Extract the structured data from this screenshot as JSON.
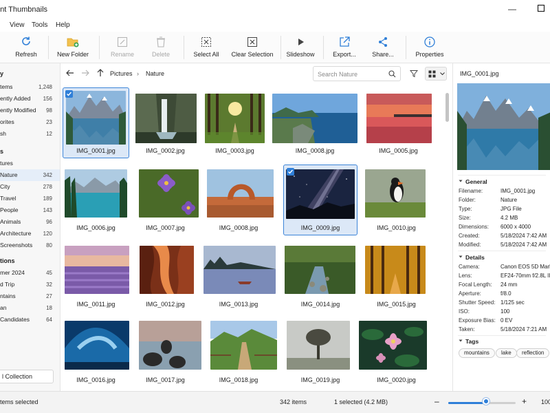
{
  "window": {
    "title": "ent Thumbnails"
  },
  "menu": [
    "t",
    "View",
    "Tools",
    "Help"
  ],
  "toolbar": {
    "refresh": "Refresh",
    "new_folder": "New Folder",
    "rename": "Rename",
    "delete": "Delete",
    "select_all": "Select All",
    "clear_selection": "Clear Selection",
    "slideshow": "Slideshow",
    "export": "Export...",
    "share": "Share...",
    "properties": "Properties"
  },
  "sidebar": {
    "library_head": "y",
    "library": [
      {
        "label": "tems",
        "count": "1,248"
      },
      {
        "label": "ently Added",
        "count": "156"
      },
      {
        "label": "ently Modified",
        "count": "98"
      },
      {
        "label": "orites",
        "count": "23"
      },
      {
        "label": "sh",
        "count": "12"
      }
    ],
    "folders_head": "s",
    "folders_parent": "tures",
    "folders": [
      {
        "label": "Nature",
        "count": "342"
      },
      {
        "label": "City",
        "count": "278"
      },
      {
        "label": "Travel",
        "count": "189"
      },
      {
        "label": "People",
        "count": "143"
      },
      {
        "label": "Animals",
        "count": "96"
      },
      {
        "label": "Architecture",
        "count": "120"
      },
      {
        "label": "Screenshots",
        "count": "80"
      }
    ],
    "collections_head": "tions",
    "collections": [
      {
        "label": "mer 2024",
        "count": "45"
      },
      {
        "label": "d Trip",
        "count": "32"
      },
      {
        "label": "ntains",
        "count": "27"
      },
      {
        "label": "an",
        "count": "18"
      },
      {
        "label": " Candidates",
        "count": "64"
      }
    ],
    "new_collection": "l Collection"
  },
  "nav": {
    "crumbs": [
      "Pictures",
      "Nature"
    ],
    "search_placeholder": "Search Nature"
  },
  "images": [
    "IMG_0001.jpg",
    "IMG_0002.jpg",
    "IMG_0003.jpg",
    "IMG_0008.jpg",
    "IMG_0005.jpg",
    "IMG_0006.jpg",
    "IMG_0007.jpg",
    "IMG_0008.jpg",
    "IMG_0009.jpg",
    "IMG_0010.jpg",
    "IMG_0011.jpg",
    "IMG_0012.jpg",
    "IMG_0013.jpg",
    "IMG_0014.jpg",
    "IMG_0015.jpg",
    "IMG_0016.jpg",
    "IMG_0017.jpg",
    "IMG_0018.jpg",
    "IMG_0019.jpg",
    "IMG_0020.jpg"
  ],
  "details": {
    "file_title": "IMG_0001.jpg",
    "general_head": "General",
    "general": [
      {
        "k": "Filename:",
        "v": "IMG_0001.jpg"
      },
      {
        "k": "Folder:",
        "v": "Nature"
      },
      {
        "k": "Type:",
        "v": "JPG File"
      },
      {
        "k": "Size:",
        "v": "4.2 MB"
      },
      {
        "k": "Dimensions:",
        "v": "6000 x 4000"
      },
      {
        "k": "Created:",
        "v": "5/18/2024 7:42 AM"
      },
      {
        "k": "Modified:",
        "v": "5/18/2024 7:42 AM"
      }
    ],
    "details_head": "Details",
    "details": [
      {
        "k": "Camera:",
        "v": "Canon EOS 5D Mark"
      },
      {
        "k": "Lens:",
        "v": "EF24-70mm f/2.8L II"
      },
      {
        "k": "Focal Length:",
        "v": "24 mm"
      },
      {
        "k": "Aperture:",
        "v": "f/8.0"
      },
      {
        "k": "Shutter Speed:",
        "v": "1/125 sec"
      },
      {
        "k": "ISO:",
        "v": "100"
      },
      {
        "k": "Exposure Bias:",
        "v": "0 EV"
      },
      {
        "k": "Taken:",
        "v": "5/18/2024 7:21 AM"
      }
    ],
    "tags_head": "Tags",
    "tags": [
      "mountains",
      "lake",
      "reflection"
    ]
  },
  "status": {
    "selected_left": "items selected",
    "count": "342 items",
    "selection": "1 selected (4.2 MB)",
    "zoom": "100",
    "zoom_fraction": 0.56
  }
}
